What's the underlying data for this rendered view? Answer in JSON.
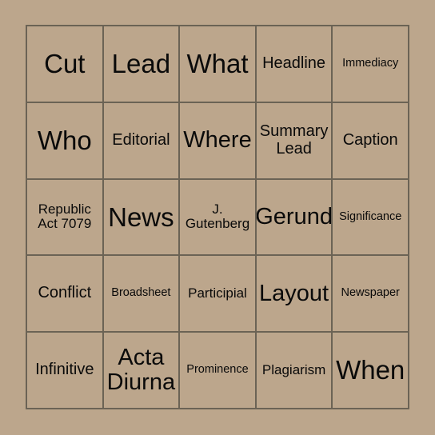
{
  "card": {
    "background_color": "#bca68c",
    "border_color": "#6b6355",
    "text_color": "#0a0a0a",
    "columns": 5,
    "rows": 5,
    "cells": [
      {
        "text": "Cut",
        "size": "sz-xl"
      },
      {
        "text": "Lead",
        "size": "sz-xl"
      },
      {
        "text": "What",
        "size": "sz-xl"
      },
      {
        "text": "Headline",
        "size": "sz-md"
      },
      {
        "text": "Immediacy",
        "size": "sz-xs"
      },
      {
        "text": "Who",
        "size": "sz-xl"
      },
      {
        "text": "Editorial",
        "size": "sz-md"
      },
      {
        "text": "Where",
        "size": "sz-lg"
      },
      {
        "text": "Summary\nLead",
        "size": "sz-md"
      },
      {
        "text": "Caption",
        "size": "sz-md"
      },
      {
        "text": "Republic\nAct 7079",
        "size": "sz-sm"
      },
      {
        "text": "News",
        "size": "sz-xl"
      },
      {
        "text": "J.\nGutenberg",
        "size": "sz-sm"
      },
      {
        "text": "Gerund",
        "size": "sz-lg"
      },
      {
        "text": "Significance",
        "size": "sz-xs"
      },
      {
        "text": "Conflict",
        "size": "sz-md"
      },
      {
        "text": "Broadsheet",
        "size": "sz-xs"
      },
      {
        "text": "Participial",
        "size": "sz-sm"
      },
      {
        "text": "Layout",
        "size": "sz-lg"
      },
      {
        "text": "Newspaper",
        "size": "sz-xs"
      },
      {
        "text": "Infinitive",
        "size": "sz-md"
      },
      {
        "text": "Acta\nDiurna",
        "size": "sz-lg"
      },
      {
        "text": "Prominence",
        "size": "sz-xs"
      },
      {
        "text": "Plagiarism",
        "size": "sz-sm"
      },
      {
        "text": "When",
        "size": "sz-xl"
      }
    ]
  }
}
